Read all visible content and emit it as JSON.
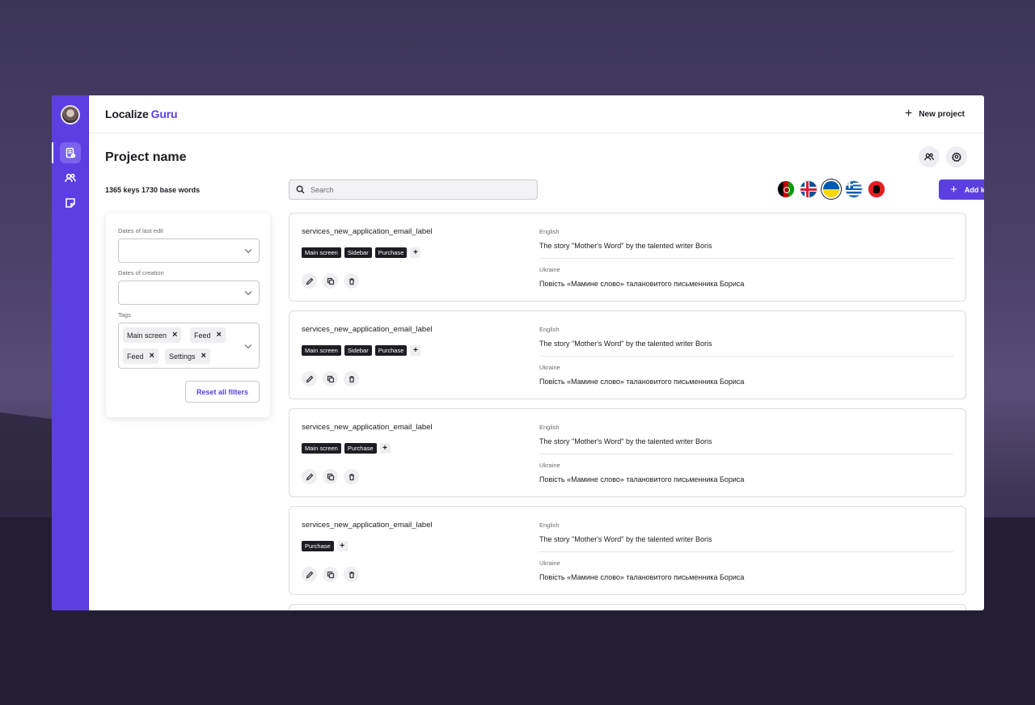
{
  "app": {
    "brand_main": "Localize",
    "brand_accent": "Guru",
    "accent_color": "#5b3fe3"
  },
  "topbar": {
    "new_project_label": "New project"
  },
  "sidebar": {
    "items": [
      {
        "icon": "document-icon",
        "active": true
      },
      {
        "icon": "users-icon",
        "active": false
      },
      {
        "icon": "note-icon",
        "active": false
      }
    ]
  },
  "page": {
    "title": "Project name",
    "stats": "1365 keys 1730 base words"
  },
  "search": {
    "placeholder": "Search",
    "value": ""
  },
  "languages": [
    "afghanistan",
    "iceland",
    "ukraine",
    "greece",
    "albania"
  ],
  "selected_language": "ukraine",
  "add_key_label": "Add key",
  "filters": {
    "last_edit_label": "Dates of last edit",
    "creation_label": "Dates of creation",
    "tags_label": "Tags",
    "selected_tags": [
      "Main screen",
      "Feed",
      "Feed",
      "Settings"
    ],
    "reset_label": "Reset all filters"
  },
  "keys": [
    {
      "name": "services_new_application_email_label",
      "tags": [
        "Main screen",
        "Sidebar",
        "Purchase"
      ],
      "src_lang": "English",
      "src_text": "The story \"Mother's Word\" by the talented writer Boris",
      "tgt_lang": "Ukraine",
      "tgt_text": "Повість «Мамине слово» талановитого письменника Бориса"
    },
    {
      "name": "services_new_application_email_label",
      "tags": [
        "Main screen",
        "Sidebar",
        "Purchase"
      ],
      "src_lang": "English",
      "src_text": "The story \"Mother's Word\" by the talented writer Boris",
      "tgt_lang": "Ukraine",
      "tgt_text": "Повість «Мамине слово» талановитого письменника Бориса"
    },
    {
      "name": "services_new_application_email_label",
      "tags": [
        "Main screen",
        "Purchase"
      ],
      "src_lang": "English",
      "src_text": "The story \"Mother's Word\" by the talented writer Boris",
      "tgt_lang": "Ukraine",
      "tgt_text": "Повість «Мамине слово» талановитого письменника Бориса"
    },
    {
      "name": "services_new_application_email_label",
      "tags": [
        "Purchase"
      ],
      "src_lang": "English",
      "src_text": "The story \"Mother's Word\" by the talented writer Boris",
      "tgt_lang": "Ukraine",
      "tgt_text": "Повість «Мамине слово» талановитого письменника Бориса"
    }
  ]
}
